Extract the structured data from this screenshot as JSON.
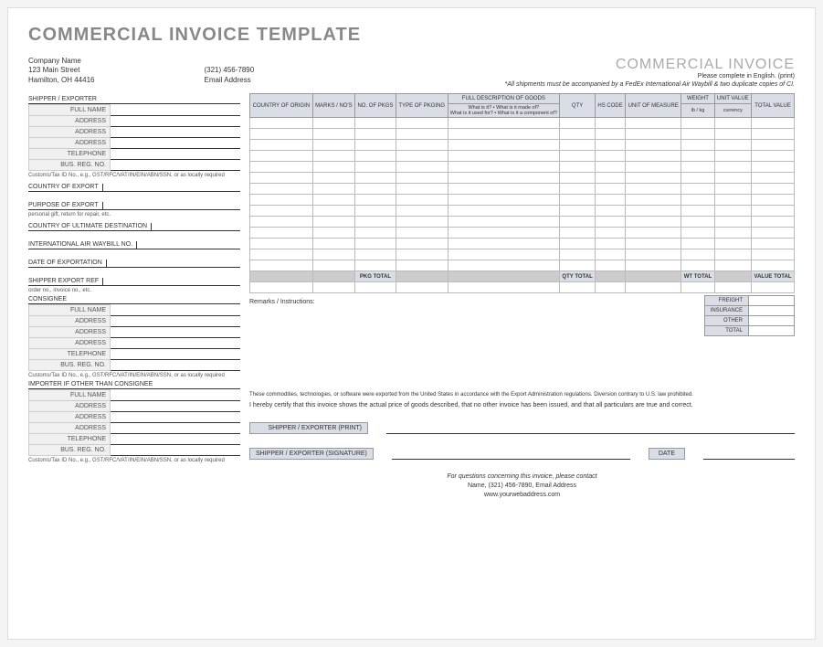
{
  "title": "COMMERCIAL INVOICE TEMPLATE",
  "company": {
    "name": "Company Name",
    "street": "123 Main Street",
    "city": "Hamilton, OH  44416",
    "phone": "(321) 456-7890",
    "email": "Email Address"
  },
  "invoice_label": "COMMERCIAL INVOICE",
  "instructions": "Please complete in English. (print)",
  "waybill_note": "*All shipments must be accompanied by a FedEx International Air Waybill & two duplicate copies of CI.",
  "shipper": {
    "title": "SHIPPER / EXPORTER",
    "fields": [
      "FULL NAME",
      "ADDRESS",
      "ADDRESS",
      "ADDRESS",
      "TELEPHONE",
      "BUS. REG. NO."
    ],
    "tax_note": "Customs/Tax ID No., e.g., GST/RFC/VAT/IN/EIN/ABN/SSN, or as locally required"
  },
  "long_fields": {
    "country_export": "COUNTRY OF EXPORT",
    "purpose": "PURPOSE OF EXPORT",
    "purpose_note": "personal gift, return for repair, etc.",
    "ultimate_dest": "COUNTRY OF ULTIMATE DESTINATION",
    "waybill_no": "INTERNATIONAL AIR WAYBILL NO.",
    "date_export": "DATE OF EXPORTATION",
    "shipper_ref": "SHIPPER EXPORT REF",
    "shipper_ref_note": "order no., invoice no., etc."
  },
  "consignee": {
    "title": "CONSIGNEE",
    "fields": [
      "FULL NAME",
      "ADDRESS",
      "ADDRESS",
      "ADDRESS",
      "TELEPHONE",
      "BUS. REG. NO."
    ]
  },
  "importer": {
    "title": "IMPORTER IF OTHER THAN CONSIGNEE",
    "fields": [
      "FULL NAME",
      "ADDRESS",
      "ADDRESS",
      "ADDRESS",
      "TELEPHONE",
      "BUS. REG. NO."
    ]
  },
  "table": {
    "headers": {
      "country": "COUNTRY OF ORIGIN",
      "marks": "MARKS / NO'S",
      "pkgs": "NO. OF PKGS",
      "pkging": "TYPE OF PKGING",
      "desc": "FULL DESCRIPTION OF GOODS",
      "desc_sub": "What is it? • What is it made of?\nWhat is it used for? • What is it a component of?",
      "qty": "QTY",
      "hs": "HS CODE",
      "uom": "UNIT OF MEASURE",
      "weight": "WEIGHT",
      "weight_sub": "lb / kg",
      "unitval": "UNIT VALUE",
      "unitval_sub": "currency",
      "total": "TOTAL VALUE"
    },
    "totals": {
      "pkg": "PKG TOTAL",
      "qty": "QTY TOTAL",
      "wt": "WT TOTAL",
      "val": "VALUE TOTAL"
    }
  },
  "remarks_label": "Remarks / Instructions:",
  "summary": {
    "freight": "FREIGHT",
    "insurance": "INSURANCE",
    "other": "OTHER",
    "total": "TOTAL"
  },
  "disclaimer": "These commodities, technologies, or software were exported from the United States in accordance with the Export Administration regulations. Diversion contrary to U.S. law prohibited.",
  "certify": "I hereby certify that this invoice shows the actual price of goods described, that no other invoice has been issued, and that all particulars are true and correct.",
  "sig": {
    "print": "SHIPPER / EXPORTER (PRINT)",
    "signature": "SHIPPER / EXPORTER (SIGNATURE)",
    "date": "DATE"
  },
  "footer": {
    "l1": "For questions concerning this invoice, please contact",
    "l2": "Name, (321) 456-7890, Email Address",
    "l3": "www.yourwebaddress.com"
  }
}
